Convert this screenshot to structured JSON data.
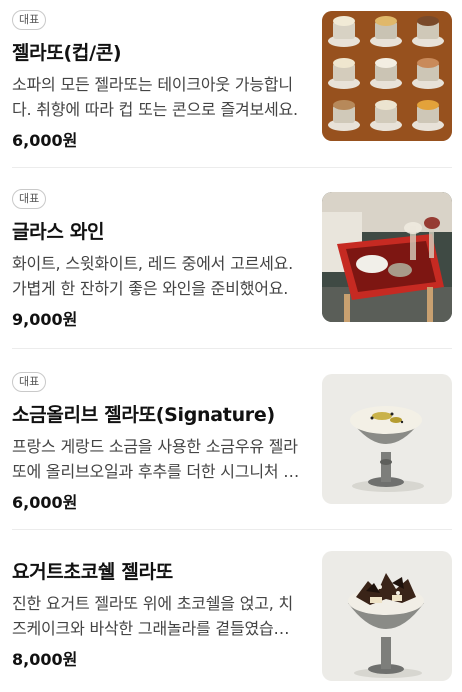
{
  "menu": {
    "items": [
      {
        "badge": "대표",
        "name": "젤라또(컵/콘)",
        "description": "소파의 모든 젤라또는 테이크아웃 가능합니다. 취향에 따라 컵 또는 콘으로 즐겨보세요.",
        "price": "6,000원",
        "image": "gelato-cups-grid-photo"
      },
      {
        "badge": "대표",
        "name": "글라스 와인",
        "description": "화이트, 스윗화이트, 레드 중에서 고르세요. 가볍게 한 잔하기 좋은 와인을 준비했어요.",
        "price": "9,000원",
        "image": "wine-glass-tray-photo"
      },
      {
        "badge": "대표",
        "name": "소금올리브 젤라또(Signature)",
        "description": "프랑스 게랑드 소금을 사용한 소금우유 젤라또에 올리브오일과 후추를 더한 시그니처 메뉴입니다.",
        "price": "6,000원",
        "image": "salt-olive-gelato-photo"
      },
      {
        "badge": "",
        "name": "요거트초코쉘 젤라또",
        "description": "진한 요거트 젤라또 위에 초코쉘을 얹고, 치즈케이크와 바삭한 그래놀라를 곁들였습니다.",
        "price": "8,000원",
        "image": "yogurt-chocoshell-gelato-photo"
      }
    ]
  }
}
